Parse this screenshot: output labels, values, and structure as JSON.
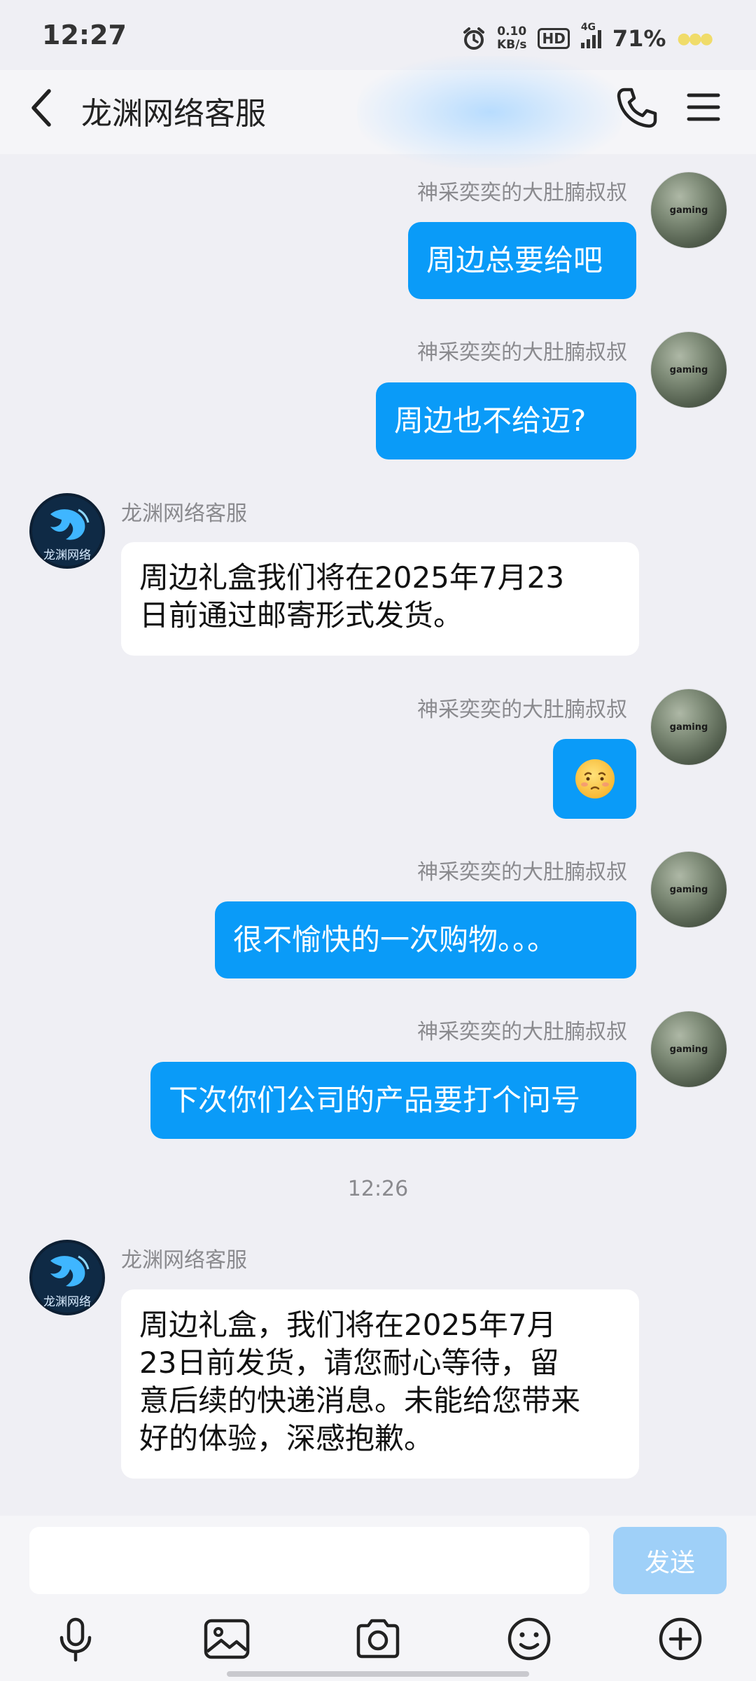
{
  "status_bar": {
    "time": "12:27",
    "net_speed_value": "0.10",
    "net_speed_unit": "KB/s",
    "hd": "HD",
    "network": "4G",
    "battery": "71%"
  },
  "header": {
    "title": "龙渊网络客服"
  },
  "messages": [
    {
      "sender": "神采奕奕的大肚腩叔叔",
      "text": "周边总要给吧"
    },
    {
      "sender": "神采奕奕的大肚腩叔叔",
      "text": "周边也不给迈?"
    },
    {
      "sender": "龙渊网络客服",
      "lines": [
        "周边礼盒我们将在2025年7月23",
        "日前通过邮寄形式发货。"
      ]
    },
    {
      "sender": "神采奕奕的大肚腩叔叔",
      "emoji": "pleading-face-emoji"
    },
    {
      "sender": "神采奕奕的大肚腩叔叔",
      "text": "很不愉快的一次购物。。。"
    },
    {
      "sender": "神采奕奕的大肚腩叔叔",
      "text": "下次你们公司的产品要打个问号"
    },
    {
      "sender": "龙渊网络客服",
      "lines": [
        "周边礼盒，我们将在2025年7月",
        "23日前发货，请您耐心等待，留",
        "意后续的快递消息。未能给您带来",
        "好的体验，深感抱歉。"
      ]
    }
  ],
  "timestamp": "12:26",
  "avatars": {
    "user_label": "gaming",
    "brand_label": "龙渊网络"
  },
  "input": {
    "placeholder": "",
    "value": "",
    "send_label": "发送"
  },
  "toolbar_icons": [
    "microphone-icon",
    "image-icon",
    "camera-icon",
    "emoji-icon",
    "plus-icon"
  ],
  "colors": {
    "bubble_out": "#0a9bf8",
    "bubble_in": "#ffffff",
    "background": "#efeff4",
    "send_disabled": "#9fd0f8"
  }
}
